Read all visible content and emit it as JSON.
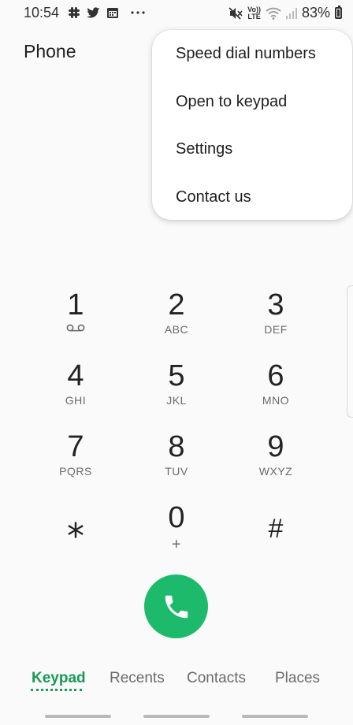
{
  "status_bar": {
    "time": "10:54",
    "left_icons": [
      "slack-icon",
      "twitter-icon",
      "calendar-icon",
      "more-dots-icon"
    ],
    "volte_top": "Vo))",
    "volte_bottom": "LTE",
    "battery": "83%"
  },
  "app": {
    "title": "Phone"
  },
  "menu": {
    "items": [
      {
        "label": "Speed dial numbers"
      },
      {
        "label": "Open to keypad"
      },
      {
        "label": "Settings"
      },
      {
        "label": "Contact us"
      }
    ]
  },
  "keypad": {
    "keys": [
      {
        "digit": "1",
        "letters": ""
      },
      {
        "digit": "2",
        "letters": "ABC"
      },
      {
        "digit": "3",
        "letters": "DEF"
      },
      {
        "digit": "4",
        "letters": "GHI"
      },
      {
        "digit": "5",
        "letters": "JKL"
      },
      {
        "digit": "6",
        "letters": "MNO"
      },
      {
        "digit": "7",
        "letters": "PQRS"
      },
      {
        "digit": "8",
        "letters": "TUV"
      },
      {
        "digit": "9",
        "letters": "WXYZ"
      },
      {
        "digit": "⁎",
        "letters": ""
      },
      {
        "digit": "0",
        "letters": "+"
      },
      {
        "digit": "#",
        "letters": ""
      }
    ]
  },
  "tabs": [
    {
      "label": "Keypad",
      "active": true
    },
    {
      "label": "Recents",
      "active": false
    },
    {
      "label": "Contacts",
      "active": false
    },
    {
      "label": "Places",
      "active": false
    }
  ],
  "colors": {
    "accent": "#1a9a55",
    "call": "#1dba6b"
  }
}
